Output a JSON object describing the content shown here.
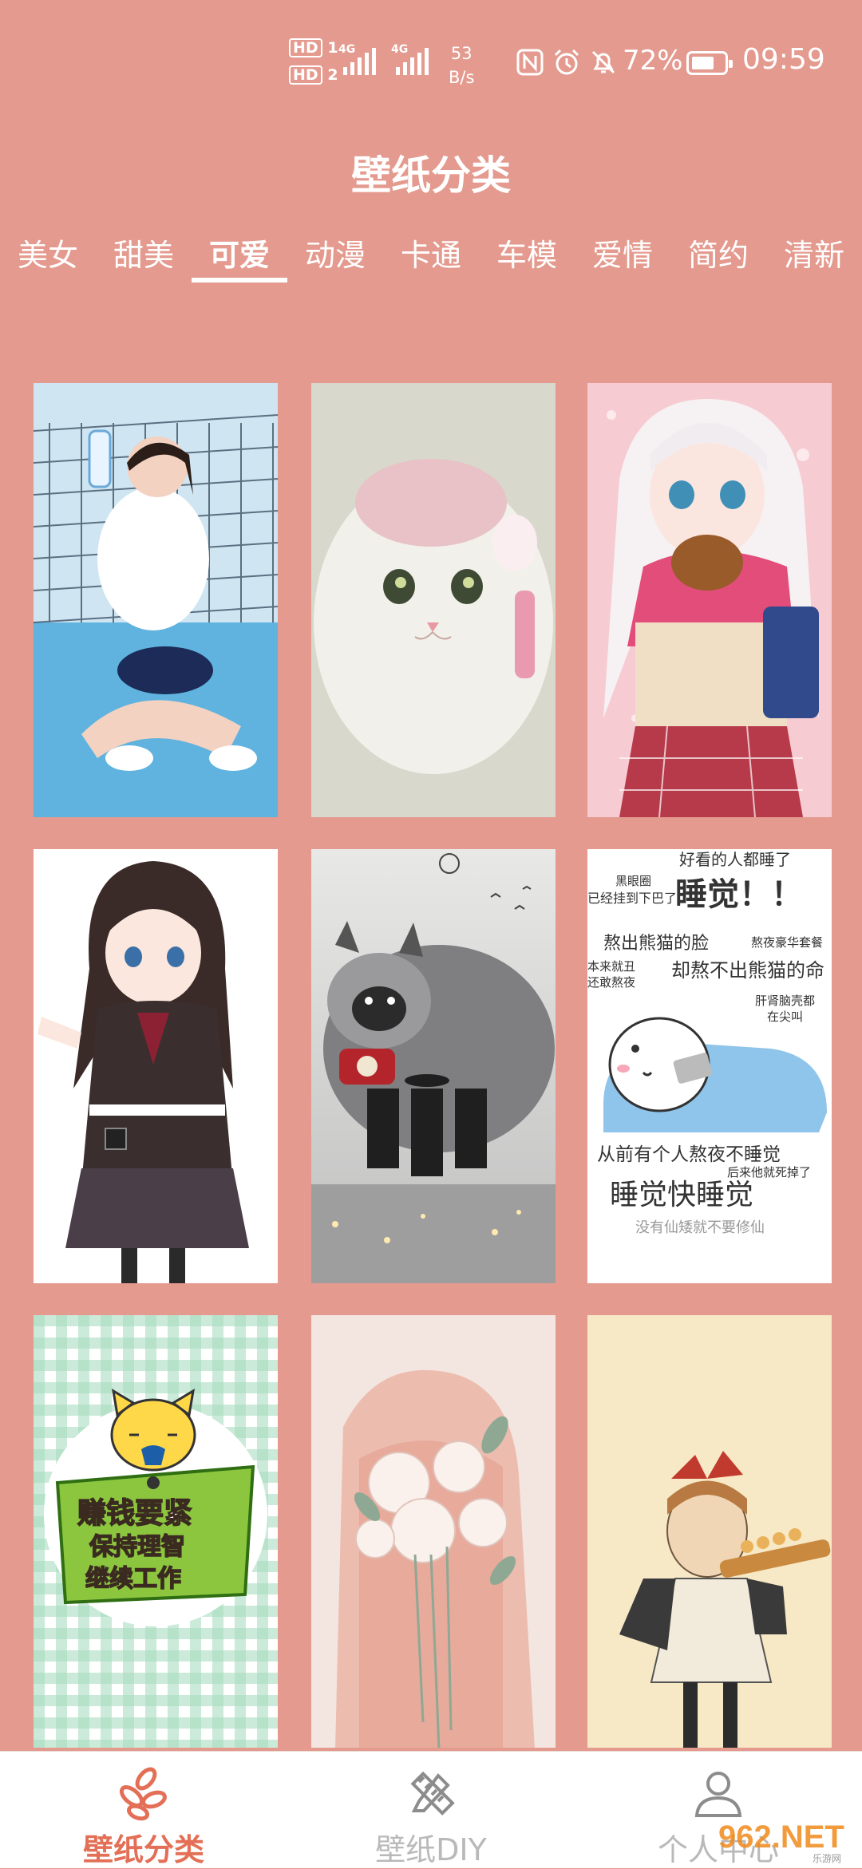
{
  "status_bar": {
    "hd1": "HD",
    "hd1_num": "1",
    "hd2": "HD",
    "hd2_num": "2",
    "net1": "4G",
    "net2": "4G",
    "speed_value": "53",
    "speed_unit": "B/s",
    "battery_percent": "72%",
    "battery_level": 0.72,
    "time": "09:59",
    "icons": [
      "nfc-icon",
      "alarm-icon",
      "mute-icon",
      "battery-icon"
    ]
  },
  "header": {
    "title": "壁纸分类"
  },
  "tabs": [
    {
      "label": "美女"
    },
    {
      "label": "甜美"
    },
    {
      "label": "可爱",
      "active": true
    },
    {
      "label": "动漫"
    },
    {
      "label": "卡通"
    },
    {
      "label": "车模"
    },
    {
      "label": "爱情"
    },
    {
      "label": "简约"
    },
    {
      "label": "清新"
    }
  ],
  "grid": {
    "items": [
      {
        "name": "wallpaper-girl-tennis-net"
      },
      {
        "name": "wallpaper-white-kitten"
      },
      {
        "name": "wallpaper-anime-girl-pink"
      },
      {
        "name": "wallpaper-anime-girl-uniform"
      },
      {
        "name": "wallpaper-raccoon-dog"
      },
      {
        "name": "wallpaper-sleep-text"
      },
      {
        "name": "wallpaper-cat-sign"
      },
      {
        "name": "wallpaper-flowers-girl"
      },
      {
        "name": "wallpaper-kiki-sketch"
      }
    ],
    "sleep_text": {
      "line1": "好看的人都睡了",
      "line2": "黑眼圈",
      "line3": "已经挂到下巴了",
      "line4": "睡觉！！",
      "line5": "熬出熊猫的脸",
      "line6": "熬夜豪华套餐",
      "line7": "本来就丑",
      "line8": "却熬不出熊猫的命",
      "line9": "还敢熬夜",
      "line10": "肝肾脑壳都",
      "line11": "在尖叫",
      "line12": "从前有个人熬夜不睡觉",
      "line13": "后来他就死掉了",
      "line14": "睡觉快睡觉",
      "line15": "没有仙矮就不要修仙"
    },
    "cat_sign_text": {
      "line1": "赚钱要紧",
      "line2": "保持理智",
      "line3": "继续工作"
    }
  },
  "bottom_nav": {
    "items": [
      {
        "label": "壁纸分类",
        "icon": "leaves-icon",
        "active": true
      },
      {
        "label": "壁纸DIY",
        "icon": "pencil-ruler-icon"
      },
      {
        "label": "个人中心",
        "icon": "user-icon"
      }
    ]
  },
  "watermark": {
    "text": "962.NET",
    "sub": "乐游网"
  },
  "colors": {
    "background": "#e49a8e",
    "accent": "#e36f56",
    "nav_inactive": "#b9b9b9"
  }
}
